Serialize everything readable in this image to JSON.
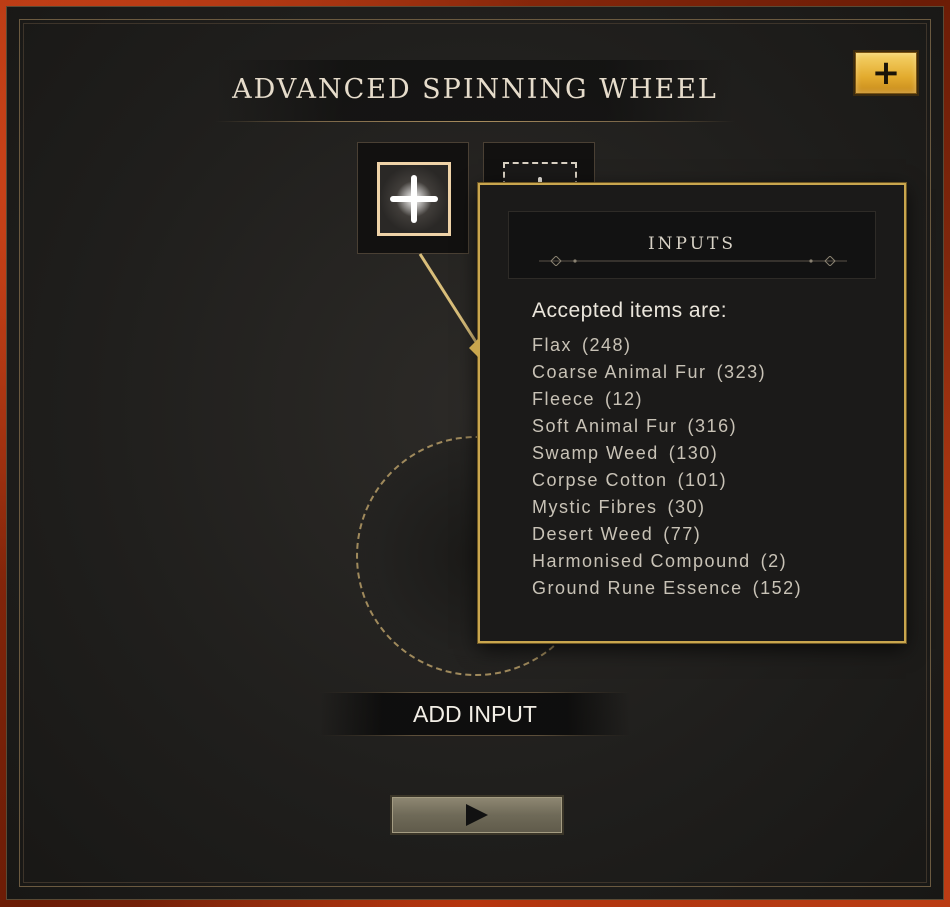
{
  "window": {
    "title": "ADVANCED SPINNING WHEEL",
    "expand_button_glyph": "+"
  },
  "slots": [
    {
      "state": "selected",
      "icon": "sparkle-cross-icon"
    },
    {
      "state": "empty",
      "icon": "sparkle-cross-icon"
    }
  ],
  "tooltip": {
    "header": "INPUTS",
    "heading": "Accepted items are:",
    "items": [
      {
        "name": "Flax",
        "count": "(248)"
      },
      {
        "name": "Coarse Animal Fur",
        "count": "(323)"
      },
      {
        "name": "Fleece",
        "count": "(12)"
      },
      {
        "name": "Soft Animal Fur",
        "count": "(316)"
      },
      {
        "name": "Swamp Weed",
        "count": "(130)"
      },
      {
        "name": "Corpse Cotton",
        "count": "(101)"
      },
      {
        "name": "Mystic Fibres",
        "count": "(30)"
      },
      {
        "name": "Desert Weed",
        "count": "(77)"
      },
      {
        "name": "Harmonised Compound",
        "count": "(2)"
      },
      {
        "name": "Ground Rune Essence",
        "count": "(152)"
      }
    ]
  },
  "actions": {
    "add_input_label": "ADD INPUT",
    "start_icon": "play-icon"
  },
  "colors": {
    "accent_gold": "#c9a64e",
    "slot_highlight": "#efd3a8",
    "button_gold": "#e3ab2e"
  }
}
